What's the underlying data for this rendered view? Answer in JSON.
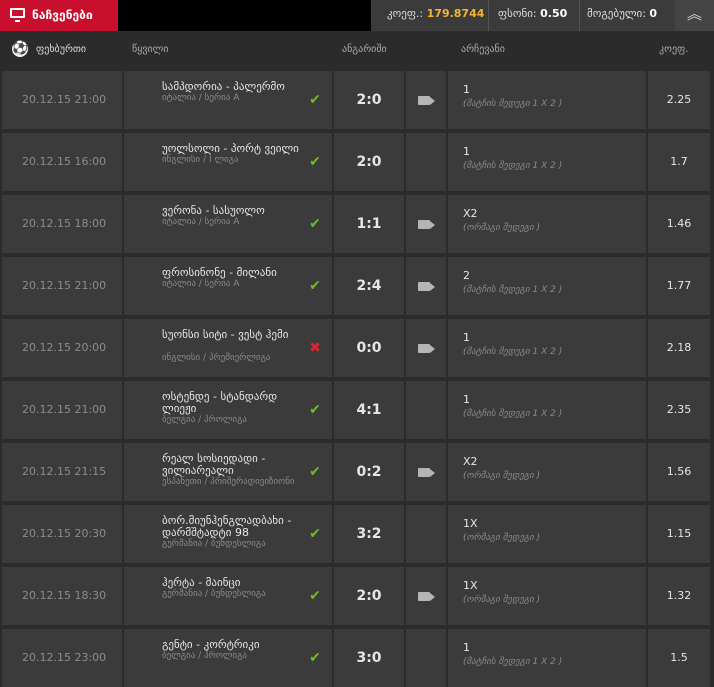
{
  "topbar": {
    "active_tab": "ნაჩვენები",
    "stats": [
      {
        "label": "კოეფ.:",
        "value": "179.8744",
        "value_color": "#f5b331"
      },
      {
        "label": "ფსონი:",
        "value": "0.50",
        "value_color": "#ffffff"
      },
      {
        "label": "მოგებული:",
        "value": "0",
        "value_color": "#ffffff"
      }
    ],
    "collapse_icon": "double-chevron-up-icon"
  },
  "columns": {
    "sport": "ფეხბურთი",
    "event": "წყვილი",
    "score": "ანგარიში",
    "pick": "არჩევანი",
    "odds": "კოეფ."
  },
  "rows": [
    {
      "date": "20.12.15 21:00",
      "teams": "სამპდორია - პალერმო",
      "league": "იტალია / სერია A",
      "status": "won",
      "score": "2:0",
      "video": true,
      "pick": "1",
      "market": "(მატჩის შედეგი 1 X 2 )",
      "odds": "2.25"
    },
    {
      "date": "20.12.15 16:00",
      "teams": "უოლსოლი - პორტ ვეილი",
      "league": "ინგლისი / I ლიგა",
      "status": "won",
      "score": "2:0",
      "video": false,
      "pick": "1",
      "market": "(მატჩის შედეგი 1 X 2 )",
      "odds": "1.7"
    },
    {
      "date": "20.12.15 18:00",
      "teams": "ვერონა - სასუოლო",
      "league": "იტალია / სერია A",
      "status": "won",
      "score": "1:1",
      "video": true,
      "pick": "X2",
      "market": "(ორმაგი შედეგი )",
      "odds": "1.46"
    },
    {
      "date": "20.12.15 21:00",
      "teams": "ფროსინონე - მილანი",
      "league": "იტალია / სერია A",
      "status": "won",
      "score": "2:4",
      "video": true,
      "pick": "2",
      "market": "(მატჩის შედეგი 1 X 2 )",
      "odds": "1.77"
    },
    {
      "date": "20.12.15 20:00",
      "teams": "სუონსი სიტი - ვესტ ჰემი",
      "league": "ინგლისი / პრემიერლიგა",
      "status": "lost",
      "score": "0:0",
      "video": true,
      "pick": "1",
      "market": "(მატჩის შედეგი 1 X 2 )",
      "odds": "2.18"
    },
    {
      "date": "20.12.15 21:00",
      "teams": "ოსტენდე - სტანდარდ ლიეჟი",
      "league": "ბელგია / პროლიგა",
      "status": "won",
      "score": "4:1",
      "video": false,
      "pick": "1",
      "market": "(მატჩის შედეგი 1 X 2 )",
      "odds": "2.35"
    },
    {
      "date": "20.12.15 21:15",
      "teams": "რეალ სოსიედადი - ვილიარეალი",
      "league": "ესპანეთი / პრიმერადივიზიონი",
      "status": "won",
      "score": "0:2",
      "video": true,
      "pick": "X2",
      "market": "(ორმაგი შედეგი )",
      "odds": "1.56"
    },
    {
      "date": "20.12.15 20:30",
      "teams": "ბორ.მიუნჰენგლადბახი - დარმშტადტი 98",
      "league": "გერმანია / ბუნდესლიგა",
      "status": "won",
      "score": "3:2",
      "video": false,
      "pick": "1X",
      "market": "(ორმაგი შედეგი )",
      "odds": "1.15"
    },
    {
      "date": "20.12.15 18:30",
      "teams": "ჰერტა - მაინცი",
      "league": "გერმანია / ბუნდესლიგა",
      "status": "won",
      "score": "2:0",
      "video": true,
      "pick": "1X",
      "market": "(ორმაგი შედეგი )",
      "odds": "1.32"
    },
    {
      "date": "20.12.15 23:00",
      "teams": "გენტი - კორტრიკი",
      "league": "ბელგია / პროლიგა",
      "status": "won",
      "score": "3:0",
      "video": false,
      "pick": "1",
      "market": "(მატჩის შედეგი 1 X 2 )",
      "odds": "1.5"
    }
  ]
}
